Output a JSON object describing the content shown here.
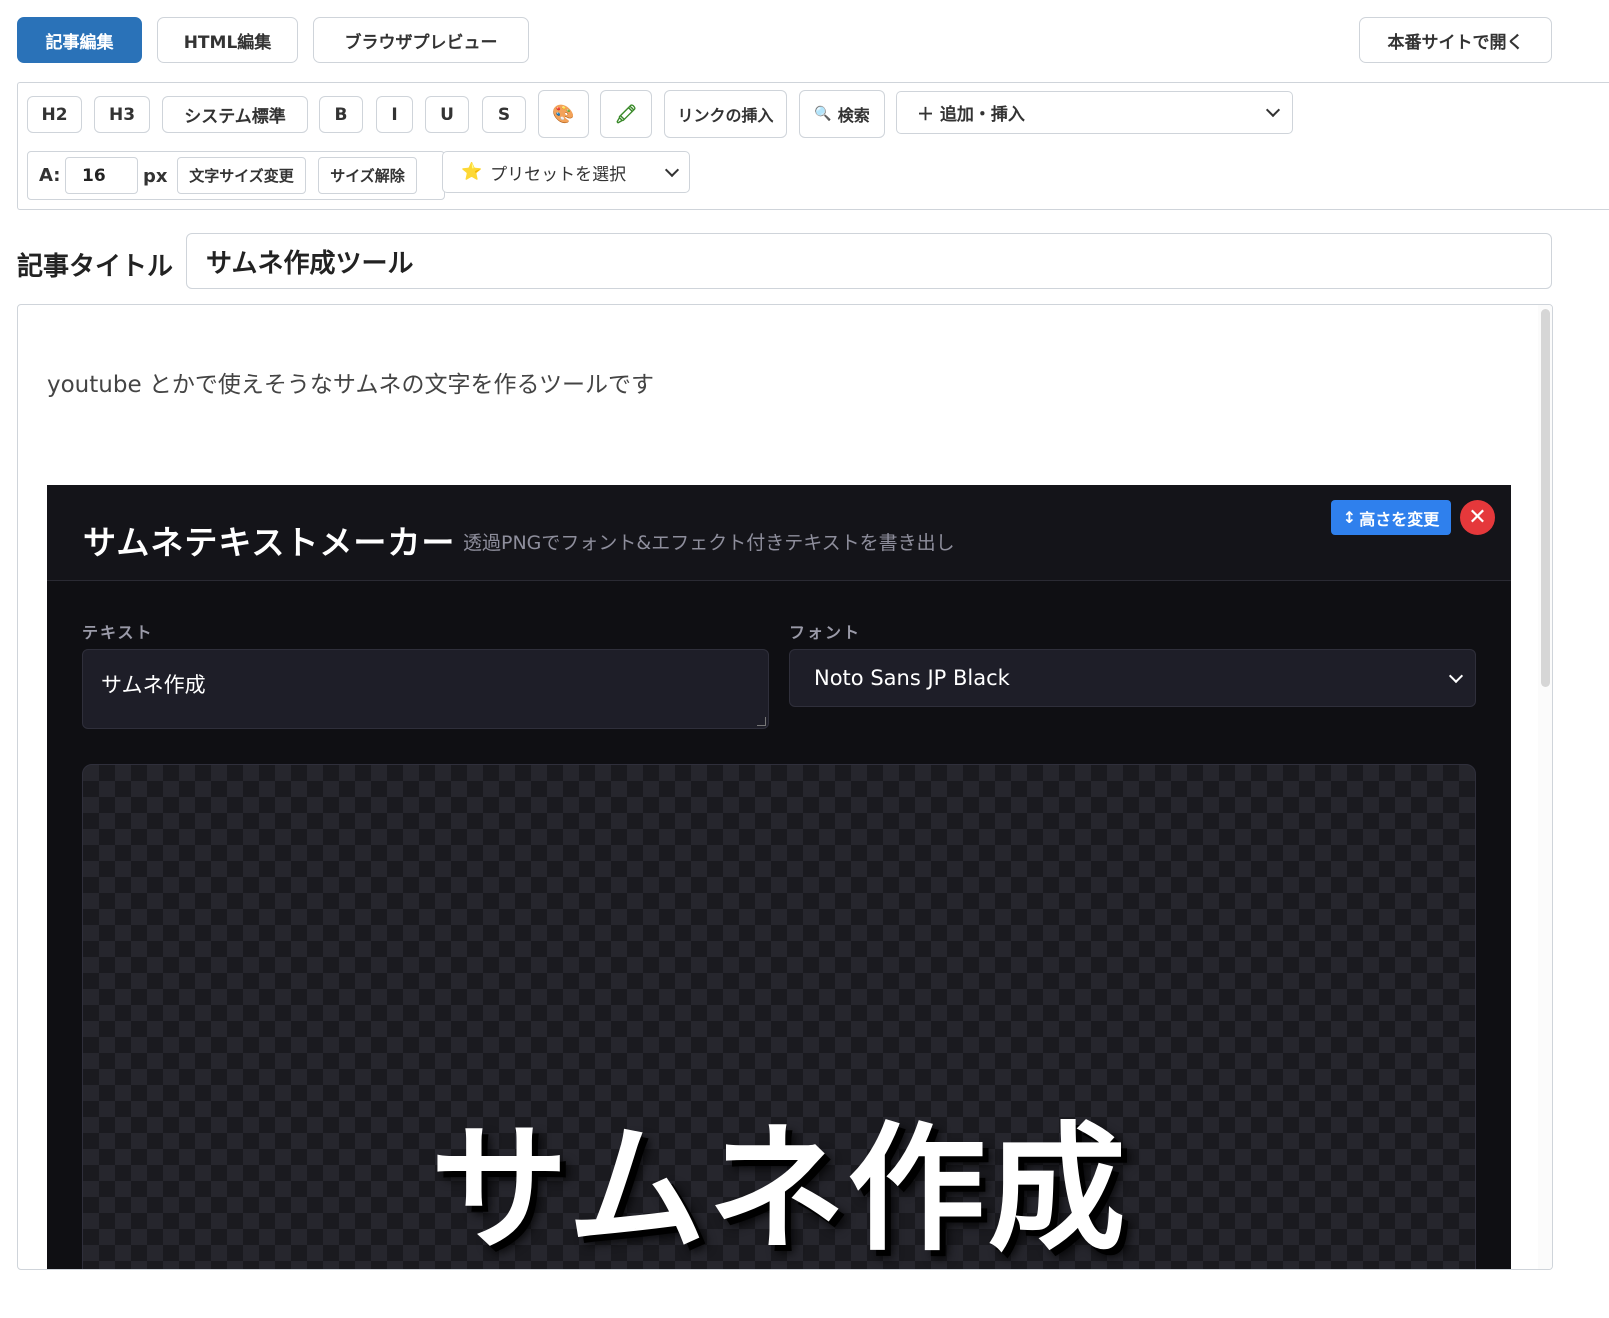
{
  "tabs": {
    "edit": "記事編集",
    "html": "HTML編集",
    "preview": "ブラウザプレビュー",
    "open_site": "本番サイトで開く"
  },
  "toolbar": {
    "h2": "H2",
    "h3": "H3",
    "system_font": "システム標準",
    "bold": "B",
    "italic": "I",
    "underline": "U",
    "strike": "S",
    "color_icon": "🎨",
    "highlight_icon": "🖍",
    "insert_link": "リンクの挿入",
    "search_icon": "🔍",
    "search": "検索",
    "add_insert": "＋ 追加・挿入",
    "size_prefix": "A:",
    "size_value": "16",
    "size_unit": "px",
    "change_size": "文字サイズ変更",
    "clear_size": "サイズ解除",
    "preset_icon": "⭐",
    "preset": "プリセットを選択"
  },
  "article": {
    "title_label": "記事タイトル",
    "title_value": "サムネ作成ツール",
    "intro": "youtube とかで使えそうなサムネの文字を作るツールです"
  },
  "app": {
    "title": "サムネテキストメーカー",
    "subtitle": "透過PNGでフォント&エフェクト付きテキストを書き出し",
    "resize_icon": "↕",
    "resize_label": "高さを変更",
    "close_icon": "✕",
    "text_label": "テキスト",
    "text_value": "サムネ作成",
    "font_label": "フォント",
    "font_value": "Noto Sans JP Black",
    "preview_text": "サムネ作成"
  },
  "colors": {
    "accent": "#2a72b8",
    "app_bg": "#0f0f13",
    "resize_btn": "#2f80ed",
    "close_btn": "#e5383b"
  }
}
